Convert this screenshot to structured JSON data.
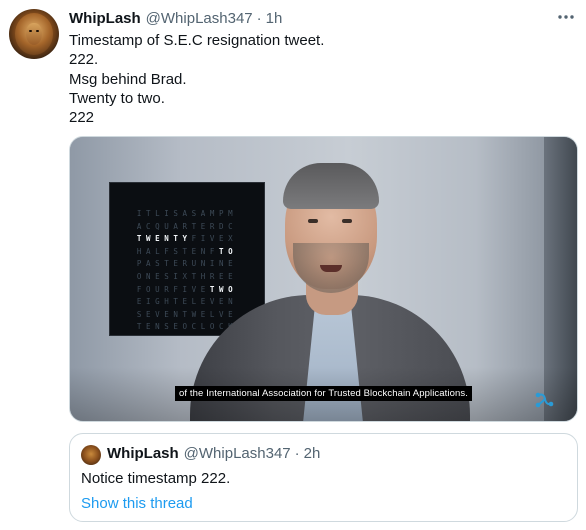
{
  "tweet": {
    "author_name": "WhipLash",
    "author_handle": "@WhipLash347",
    "separator": "·",
    "time": "1h",
    "lines": [
      "Timestamp of S.E.C resignation tweet.",
      "222.",
      "Msg behind Brad.",
      "Twenty to two.",
      "222"
    ],
    "more_icon": "more-horizontal-icon"
  },
  "media": {
    "clock_rows": [
      {
        "text": "ITLISASAMPM",
        "highlight": ""
      },
      {
        "text": "ACQUARTERDC",
        "highlight": ""
      },
      {
        "text": "TWENTYFIVEX",
        "highlight": "TWENTY"
      },
      {
        "text": "HALFSTENFTO",
        "highlight": "TO"
      },
      {
        "text": "PASTERUNINE",
        "highlight": ""
      },
      {
        "text": "ONESIXTHREE",
        "highlight": ""
      },
      {
        "text": "FOURFIVETWO",
        "highlight": "TWO"
      },
      {
        "text": "EIGHTELEVEN",
        "highlight": ""
      },
      {
        "text": "SEVENTWELVE",
        "highlight": ""
      },
      {
        "text": "TENSEOCLOCK",
        "highlight": ""
      }
    ],
    "caption": "of the International Association for Trusted Blockchain Applications.",
    "brand_icon": "ripple-logo-icon",
    "brand_color": "#2a9bd6"
  },
  "quote": {
    "author_name": "WhipLash",
    "author_handle": "@WhipLash347",
    "separator": "·",
    "time": "2h",
    "text": "Notice timestamp 222.",
    "link_text": "Show this thread"
  },
  "colors": {
    "text_primary": "#0f1419",
    "text_secondary": "#536471",
    "link": "#1d9bf0",
    "border": "#cfd9de"
  }
}
